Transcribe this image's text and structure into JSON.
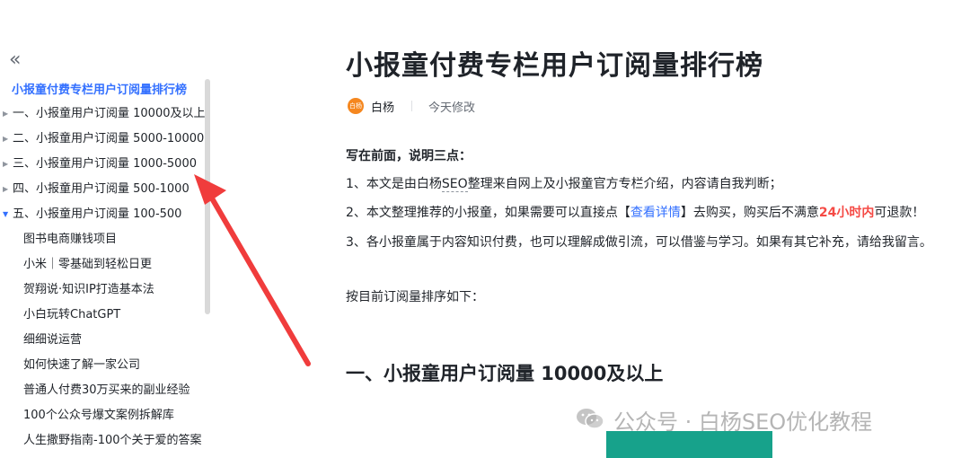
{
  "sidebar": {
    "title": "小报童付费专栏用户订阅量排行榜",
    "items": [
      {
        "label": "一、小报童用户订阅量 10000及以上",
        "arrow": "▶",
        "expanded": false,
        "child": false
      },
      {
        "label": "二、小报童用户订阅量 5000-10000",
        "arrow": "▶",
        "expanded": false,
        "child": false
      },
      {
        "label": "三、小报童用户订阅量 1000-5000",
        "arrow": "▶",
        "expanded": false,
        "child": false
      },
      {
        "label": "四、小报童用户订阅量 500-1000",
        "arrow": "▶",
        "expanded": false,
        "child": false
      },
      {
        "label": "五、小报童用户订阅量 100-500",
        "arrow": "▼",
        "expanded": true,
        "child": false
      },
      {
        "label": "图书电商赚钱项目",
        "arrow": "",
        "expanded": false,
        "child": true
      },
      {
        "label": "小米｜零基础到轻松日更",
        "arrow": "",
        "expanded": false,
        "child": true
      },
      {
        "label": "贺翔说·知识IP打造基本法",
        "arrow": "",
        "expanded": false,
        "child": true
      },
      {
        "label": "小白玩转ChatGPT",
        "arrow": "",
        "expanded": false,
        "child": true
      },
      {
        "label": "细细说运营",
        "arrow": "",
        "expanded": false,
        "child": true
      },
      {
        "label": "如何快速了解一家公司",
        "arrow": "",
        "expanded": false,
        "child": true
      },
      {
        "label": "普通人付费30万买来的副业经验",
        "arrow": "",
        "expanded": false,
        "child": true
      },
      {
        "label": "100个公众号爆文案例拆解库",
        "arrow": "",
        "expanded": false,
        "child": true
      },
      {
        "label": "人生撒野指南-100个关于爱的答案",
        "arrow": "",
        "expanded": false,
        "child": true
      }
    ]
  },
  "doc": {
    "title": "小报童付费专栏用户订阅量排行榜",
    "avatar_text": "白杨",
    "author": "白杨",
    "modified": "今天修改",
    "intro_heading": "写在前面，说明三点：",
    "point1_a": "1、本文是由白杨",
    "point1_b": "SEO",
    "point1_c": "整理来自网上及小报童官方专栏介绍，内容请自我判断；",
    "point2_a": "2、本文整理推荐的小报童，如果需要可以直接点【",
    "point2_link": "查看详情",
    "point2_b": "】去购买，购买后不满意",
    "point2_red": "24小时内",
    "point2_c": "可退款！",
    "point3": "3、各小报童属于内容知识付费，也可以理解成做引流，可以借鉴与学习。如果有其它补充，请给我留言。",
    "order_note": "按目前订阅量排序如下：",
    "section1": "一、小报童用户订阅量 10000及以上"
  },
  "watermark": {
    "text": "公众号 · 白杨SEO优化教程"
  },
  "colors": {
    "accent": "#3370ff",
    "highlight_red": "#f54a45",
    "annotation_arrow": "#f03c3c",
    "avatar_bg": "#f5871f",
    "teal_block": "#17a28b"
  }
}
